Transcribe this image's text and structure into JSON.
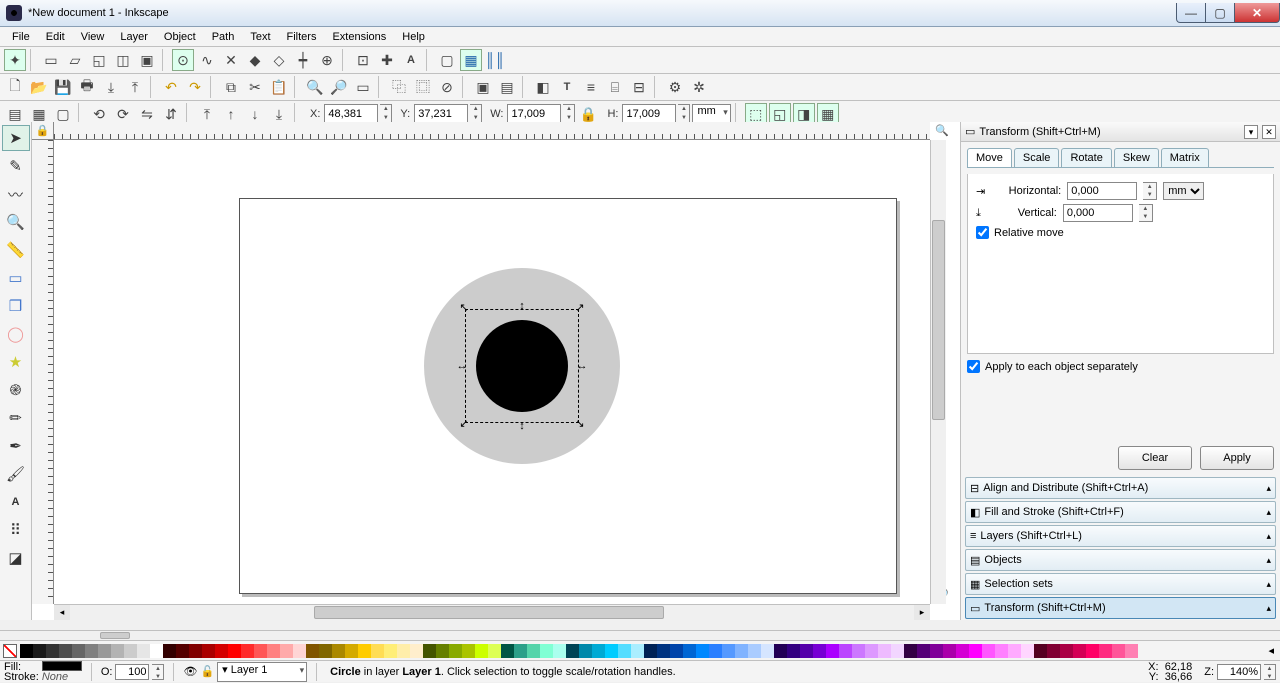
{
  "window": {
    "title": "*New document 1 - Inkscape"
  },
  "menu": [
    "File",
    "Edit",
    "View",
    "Layer",
    "Object",
    "Path",
    "Text",
    "Filters",
    "Extensions",
    "Help"
  ],
  "coords": {
    "x_label": "X:",
    "x": "48,381",
    "y_label": "Y:",
    "y": "37,231",
    "w_label": "W:",
    "w": "17,009",
    "h_label": "H:",
    "h": "17,009",
    "unit": "mm"
  },
  "transform_panel": {
    "title": "Transform (Shift+Ctrl+M)",
    "tabs": [
      "Move",
      "Scale",
      "Rotate",
      "Skew",
      "Matrix"
    ],
    "horizontal_label": "Horizontal:",
    "vertical_label": "Vertical:",
    "horizontal": "0,000",
    "vertical": "0,000",
    "unit": "mm",
    "relative_label": "Relative move",
    "apply_each_label": "Apply to each object separately",
    "clear": "Clear",
    "apply": "Apply"
  },
  "dock_panels": [
    "Align and Distribute (Shift+Ctrl+A)",
    "Fill and Stroke (Shift+Ctrl+F)",
    "Layers (Shift+Ctrl+L)",
    "Objects",
    "Selection sets",
    "Transform (Shift+Ctrl+M)"
  ],
  "status": {
    "fill_label": "Fill:",
    "stroke_label": "Stroke:",
    "stroke_value": "None",
    "opacity_label": "O:",
    "opacity": "100",
    "layer": "Layer 1",
    "msg_prefix": "Circle",
    "msg_mid": " in layer ",
    "msg_layer": "Layer 1",
    "msg_suffix": ". Click selection to toggle scale/rotation handles.",
    "cx_label": "X:",
    "cx": "62,18",
    "cy_label": "Y:",
    "cy": "36,66",
    "z_label": "Z:",
    "zoom": "140%"
  },
  "palette_colors": [
    "#000000",
    "#1a1a1a",
    "#333333",
    "#4d4d4d",
    "#666666",
    "#808080",
    "#999999",
    "#b3b3b3",
    "#cccccc",
    "#e6e6e6",
    "#ffffff",
    "#330000",
    "#550000",
    "#800000",
    "#aa0000",
    "#d40000",
    "#ff0000",
    "#ff2a2a",
    "#ff5555",
    "#ff8080",
    "#ffaaaa",
    "#ffd5d5",
    "#805500",
    "#806600",
    "#aa8800",
    "#d4aa00",
    "#ffcc00",
    "#ffdd55",
    "#ffee77",
    "#ffeeaa",
    "#ffeecc",
    "#445500",
    "#668000",
    "#88aa00",
    "#aac400",
    "#ccff00",
    "#ddff55",
    "#005544",
    "#2ca089",
    "#55d4aa",
    "#80ffd4",
    "#aaffee",
    "#004455",
    "#0088aa",
    "#00aad4",
    "#00ccff",
    "#55ddff",
    "#aaeeff",
    "#002255",
    "#003380",
    "#0044aa",
    "#0066d4",
    "#0088ff",
    "#2a7fff",
    "#5599ff",
    "#80b3ff",
    "#aaccff",
    "#d5e5ff",
    "#220055",
    "#330080",
    "#5500aa",
    "#7700d4",
    "#aa00ff",
    "#bb44ff",
    "#cc77ff",
    "#dd99ff",
    "#eebbff",
    "#f2d5ff",
    "#330044",
    "#550077",
    "#800099",
    "#aa00aa",
    "#d400d4",
    "#ff00ff",
    "#ff55ff",
    "#ff80ff",
    "#ffaaff",
    "#ffd5ff",
    "#550022",
    "#800033",
    "#aa0044",
    "#d40055",
    "#ff0066",
    "#ff2a80",
    "#ff5599",
    "#ff80b3"
  ]
}
